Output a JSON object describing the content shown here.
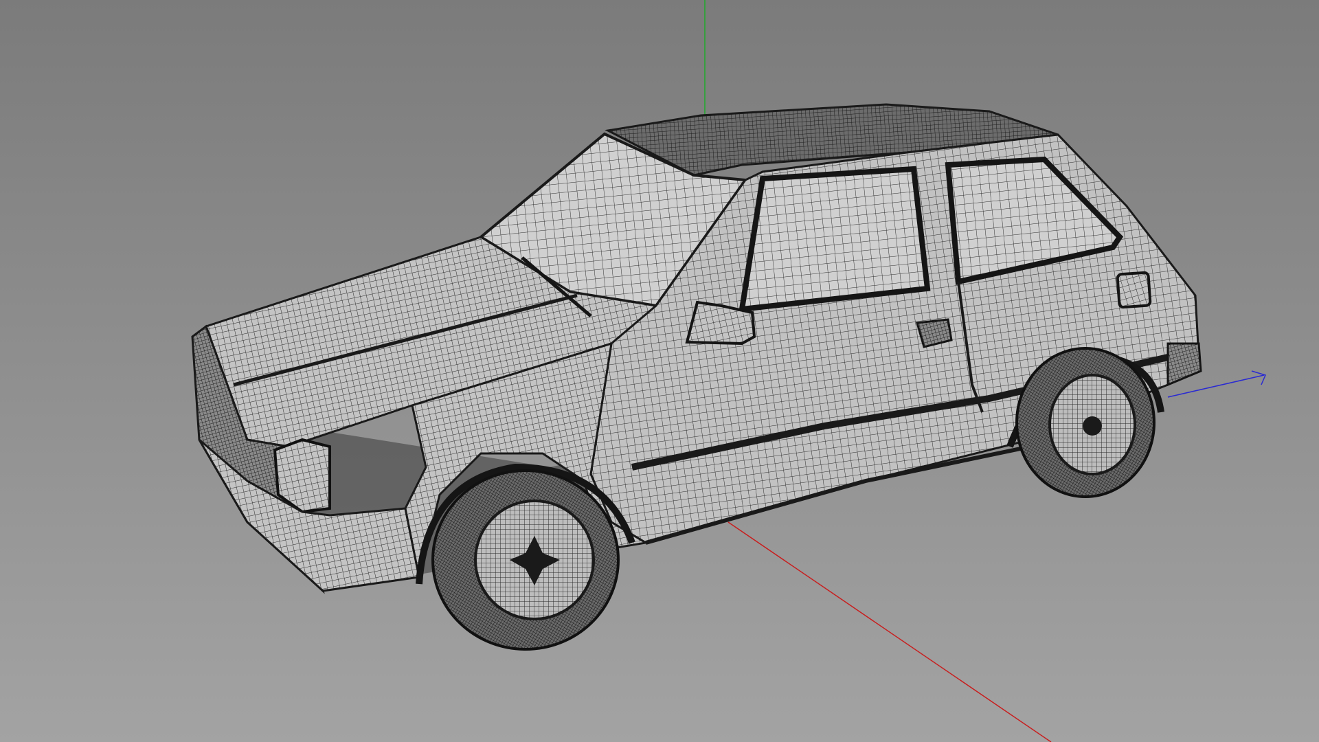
{
  "viewport": {
    "background_top": "#7b7b7b",
    "background_bottom": "#a3a3a3"
  },
  "scene": {
    "model": "car-wireframe",
    "render_mode": "wireframe",
    "wire_color": "#2a2a2a",
    "surface_color": "#c9c9c9"
  },
  "axes": {
    "x_color": "#c81e1e",
    "y_color": "#1eaa2a",
    "z_color": "#2a2ad2"
  }
}
